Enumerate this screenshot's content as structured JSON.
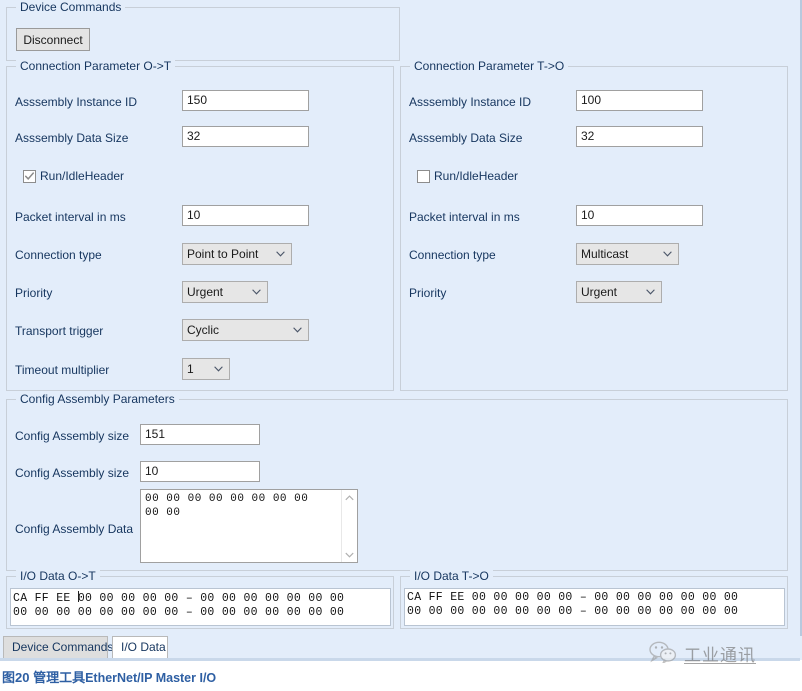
{
  "window": {
    "background_color": "#e3edfa"
  },
  "device_commands": {
    "group_title": "Device Commands",
    "disconnect_label": "Disconnect"
  },
  "connection_ot": {
    "group_title": "Connection Parameter O->T",
    "assembly_instance_id_label": "Asssembly Instance ID",
    "assembly_instance_id_value": "150",
    "assembly_data_size_label": "Asssembly Data Size",
    "assembly_data_size_value": "32",
    "run_idle_header_label": "Run/IdleHeader",
    "run_idle_header_checked": true,
    "packet_interval_label": "Packet interval in ms",
    "packet_interval_value": "10",
    "connection_type_label": "Connection type",
    "connection_type_value": "Point to Point",
    "priority_label": "Priority",
    "priority_value": "Urgent",
    "transport_trigger_label": "Transport trigger",
    "transport_trigger_value": "Cyclic",
    "timeout_multiplier_label": "Timeout multiplier",
    "timeout_multiplier_value": "1"
  },
  "connection_to": {
    "group_title": "Connection Parameter T->O",
    "assembly_instance_id_label": "Asssembly Instance ID",
    "assembly_instance_id_value": "100",
    "assembly_data_size_label": "Asssembly Data Size",
    "assembly_data_size_value": "32",
    "run_idle_header_label": "Run/IdleHeader",
    "run_idle_header_checked": false,
    "packet_interval_label": "Packet interval in ms",
    "packet_interval_value": "10",
    "connection_type_label": "Connection type",
    "connection_type_value": "Multicast",
    "priority_label": "Priority",
    "priority_value": "Urgent"
  },
  "config_assembly": {
    "group_title": "Config Assembly Parameters",
    "size_label_1": "Config Assembly size",
    "size_value_1": "151",
    "size_label_2": "Config Assembly size",
    "size_value_2": "10",
    "data_label": "Config Assembly Data",
    "data_value": "00 00 00 00 00 00 00 00\n00 00"
  },
  "io_data_ot": {
    "group_title": "I/O Data O->T",
    "line1_prefix": "CA FF EE ",
    "line1_rest": "00 00 00 00 00 – 00 00 00 00 00 00 00",
    "line2": "00 00 00 00 00 00 00 00 – 00 00 00 00 00 00 00"
  },
  "io_data_to": {
    "group_title": "I/O Data T->O",
    "line1": "CA FF EE 00 00 00 00 00 – 00 00 00 00 00 00 00",
    "line2": "00 00 00 00 00 00 00 00 – 00 00 00 00 00 00 00"
  },
  "tabs": [
    {
      "label": "Device Commands",
      "active": false
    },
    {
      "label": "I/O Data",
      "active": true
    }
  ],
  "watermark": {
    "text": "工业通讯",
    "icon": "wechat-icon"
  },
  "caption": {
    "figure_number": "图20 管理工具",
    "figure_title": "EtherNet/IP Master I/O",
    "color": "#2e5fa3"
  }
}
